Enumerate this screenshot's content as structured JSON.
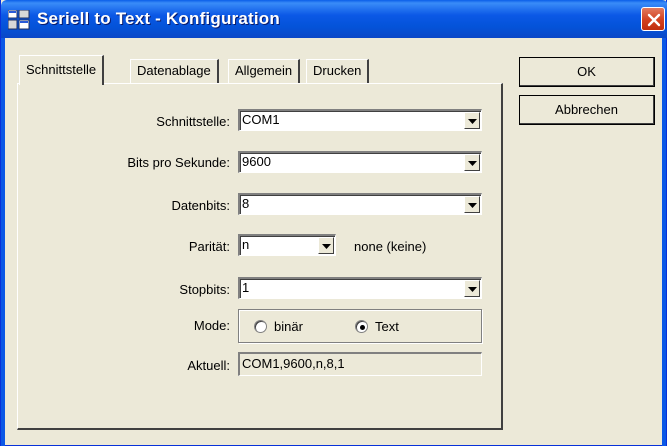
{
  "window": {
    "title": "Seriell to Text - Konfiguration",
    "title_bar_color": "#0b58e6"
  },
  "icons": {
    "app": "app-window-icon",
    "close": "close-icon",
    "dropdown": "chevron-down-icon"
  },
  "tabs": [
    {
      "label": "Schnittstelle",
      "active": true
    },
    {
      "label": "Datenablage",
      "active": false
    },
    {
      "label": "Allgemein",
      "active": false
    },
    {
      "label": "Drucken",
      "active": false
    }
  ],
  "form": {
    "schnittstelle": {
      "label": "Schnittstelle:",
      "value": "COM1"
    },
    "bits_pro_sekunde": {
      "label": "Bits pro Sekunde:",
      "value": "9600"
    },
    "datenbits": {
      "label": "Datenbits:",
      "value": "8"
    },
    "paritaet": {
      "label": "Parität:",
      "value": "n",
      "description": "none (keine)"
    },
    "stopbits": {
      "label": "Stopbits:",
      "value": "1"
    },
    "mode": {
      "label": "Mode:",
      "options": [
        {
          "label": "binär",
          "selected": false
        },
        {
          "label": "Text",
          "selected": true
        }
      ]
    },
    "aktuell": {
      "label": "Aktuell:",
      "value": "COM1,9600,n,8,1"
    }
  },
  "buttons": {
    "ok": "OK",
    "cancel": "Abbrechen"
  }
}
